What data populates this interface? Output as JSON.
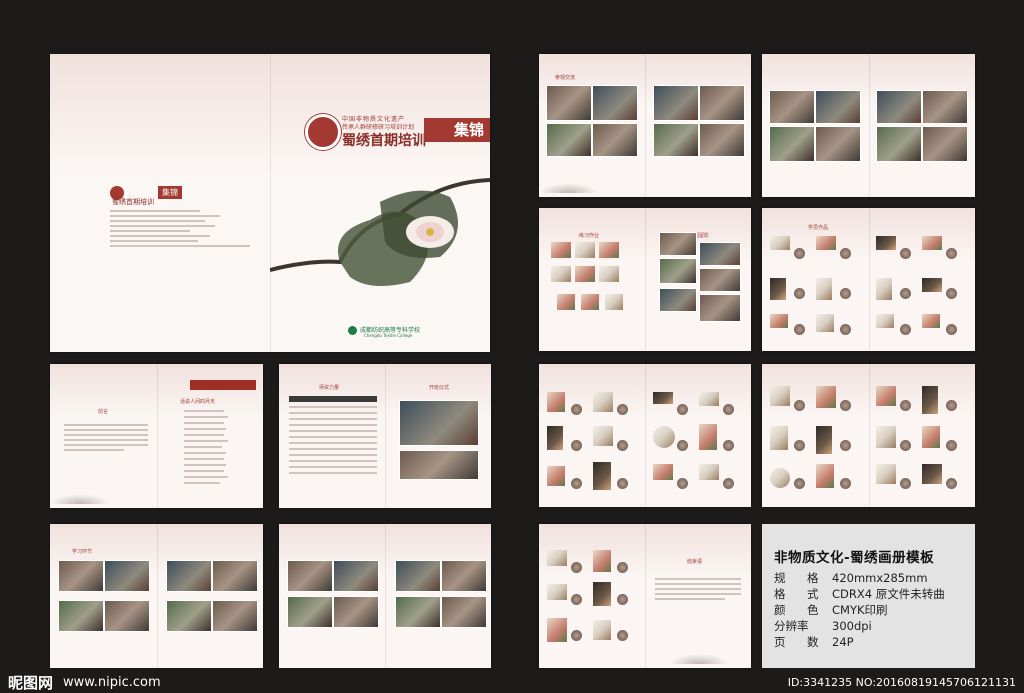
{
  "cover": {
    "org_line1": "中国非物质文化遗产",
    "org_line2": "传承人群研修研习培训计划",
    "title": "蜀绣首期培训",
    "badge": "集锦",
    "college_cn": "成都纺织高等专科学校",
    "college_en": "Chengdu Textile College",
    "back_title": "蜀绣首期培训",
    "back_badge": "集锦"
  },
  "pages": {
    "visit": "参观交流",
    "practice": "练习作业",
    "campus": "校园留影",
    "student_works": "学员作品",
    "preface": "前言",
    "poem": "话说人间四月天",
    "teachers": "师资力量",
    "opening": "开班仪式",
    "study": "学习环节",
    "conclusion": "结束语"
  },
  "info": {
    "title": "非物质文化-蜀绣画册模板",
    "rows": [
      {
        "key": "规　格",
        "val": "420mmx285mm"
      },
      {
        "key": "格　式",
        "val": "CDRX4 原文件未转曲"
      },
      {
        "key": "颜　色",
        "val": "CMYK印刷"
      },
      {
        "key": "分辨率",
        "val": "300dpi"
      },
      {
        "key": "页　数",
        "val": "24P"
      }
    ]
  },
  "footer": {
    "logo": "昵图网",
    "url": "www.nipic.com",
    "id": "ID:3341235 NO:20160819145706121131"
  }
}
